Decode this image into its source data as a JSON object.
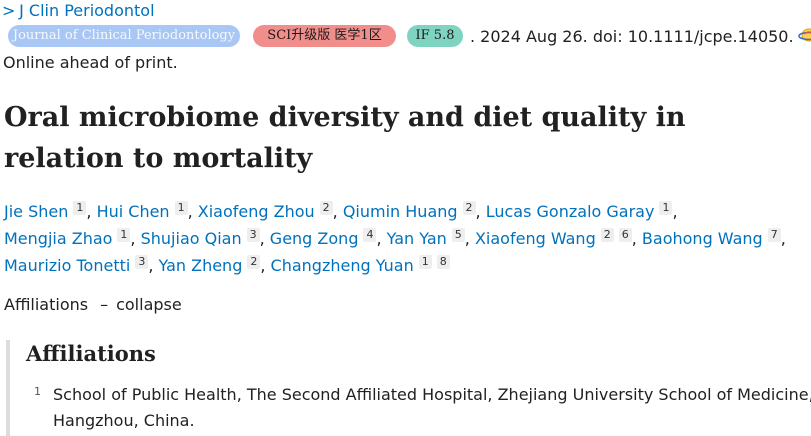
{
  "journal_link": {
    "chevron": ">",
    "name": "J Clin Periodontol"
  },
  "badges": {
    "journal_full": "Journal of Clinical Periodontology",
    "sci": "SCI升级版 医学1区",
    "impact_factor": "IF 5.8"
  },
  "citation": {
    "text": ". 2024 Aug 26. doi: 10.1111/jcpe.14050.",
    "icon": "journal-icon"
  },
  "print_status": "Online ahead of print.",
  "article_title": "Oral microbiome diversity and diet quality in relation to mortality",
  "authors": [
    {
      "name": "Jie Shen",
      "affs": [
        "1"
      ],
      "sep": ","
    },
    {
      "name": "Hui Chen",
      "affs": [
        "1"
      ],
      "sep": ","
    },
    {
      "name": "Xiaofeng Zhou",
      "affs": [
        "2"
      ],
      "sep": ","
    },
    {
      "name": "Qiumin Huang",
      "affs": [
        "2"
      ],
      "sep": ","
    },
    {
      "name": "Lucas Gonzalo Garay",
      "affs": [
        "1"
      ],
      "sep": ","
    },
    {
      "name": "Mengjia Zhao",
      "affs": [
        "1"
      ],
      "sep": ","
    },
    {
      "name": "Shujiao Qian",
      "affs": [
        "3"
      ],
      "sep": ","
    },
    {
      "name": "Geng Zong",
      "affs": [
        "4"
      ],
      "sep": ","
    },
    {
      "name": "Yan Yan",
      "affs": [
        "5"
      ],
      "sep": ","
    },
    {
      "name": "Xiaofeng Wang",
      "affs": [
        "2",
        "6"
      ],
      "sep": ","
    },
    {
      "name": "Baohong Wang",
      "affs": [
        "7"
      ],
      "sep": ","
    },
    {
      "name": "Maurizio Tonetti",
      "affs": [
        "3"
      ],
      "sep": ","
    },
    {
      "name": "Yan Zheng",
      "affs": [
        "2"
      ],
      "sep": ","
    },
    {
      "name": "Changzheng Yuan",
      "affs": [
        "1",
        "8"
      ],
      "sep": ""
    }
  ],
  "affiliations_toggle": {
    "label": "Affiliations",
    "dash": "–",
    "action": "collapse"
  },
  "affiliations_section": {
    "heading": "Affiliations",
    "items": [
      {
        "num": "1",
        "text": "School of Public Health, The Second Affiliated Hospital, Zhejiang University School of Medicine, Hangzhou, China."
      }
    ]
  },
  "colors": {
    "link": "#0071bc",
    "journal_badge": "#a9c7f4",
    "sci_badge": "#f18e8b",
    "if_badge": "#7fd4c1"
  }
}
